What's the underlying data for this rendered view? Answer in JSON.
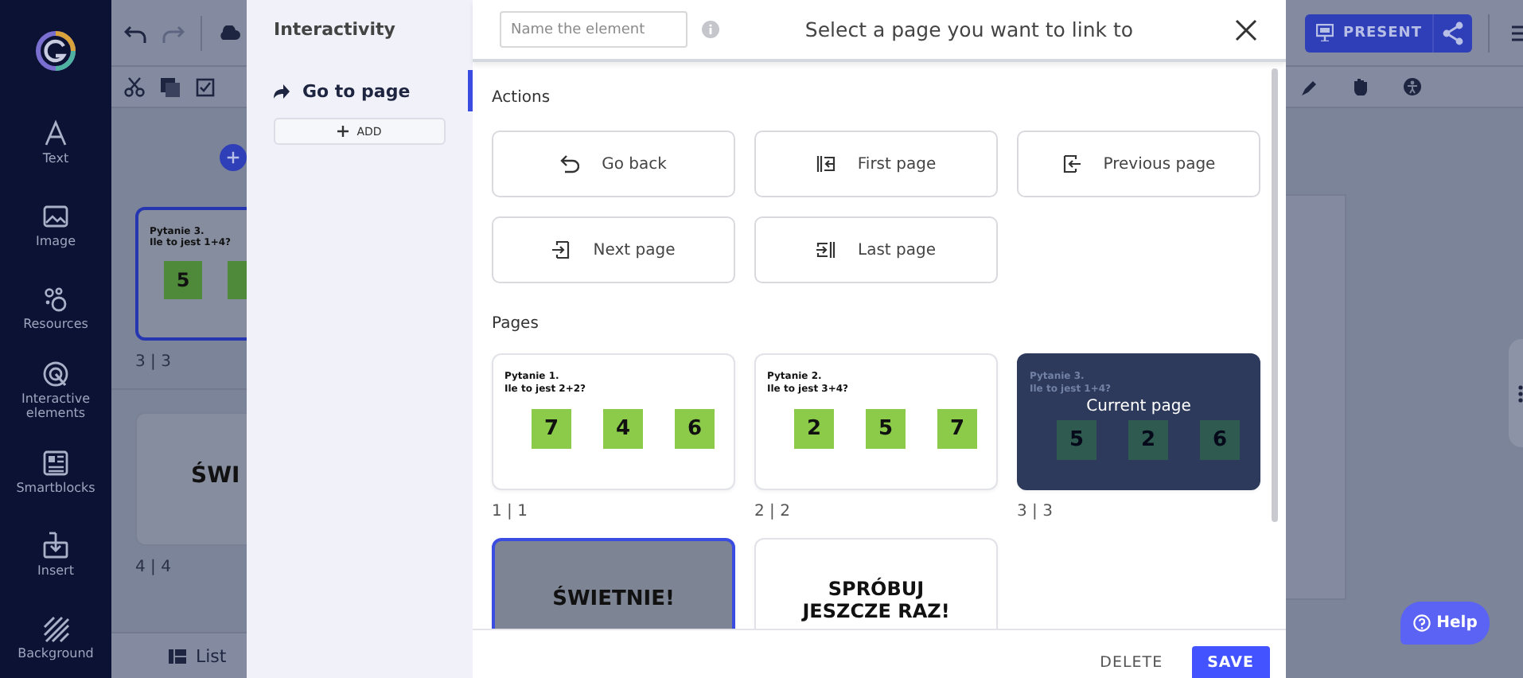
{
  "nav": {
    "items": [
      {
        "kind": "text",
        "label": "Text"
      },
      {
        "kind": "image",
        "label": "Image"
      },
      {
        "kind": "resources",
        "label": "Resources"
      },
      {
        "kind": "interactive",
        "label": "Interactive elements"
      },
      {
        "kind": "smartblocks",
        "label": "Smartblocks"
      },
      {
        "kind": "insert",
        "label": "Insert"
      },
      {
        "kind": "background",
        "label": "Background"
      }
    ]
  },
  "page_list": {
    "pages": [
      {
        "kind": "question",
        "lines": [
          "Pytanie 3.",
          "Ile to jest 1+4?"
        ],
        "answers": [
          "5"
        ],
        "number": "3 | 3",
        "selected": true
      },
      {
        "kind": "text",
        "text": "ŚWI",
        "number": "4 | 4",
        "selected": false
      }
    ],
    "list_button": "List"
  },
  "interactivity": {
    "title": "Interactivity",
    "items": [
      {
        "label": "Go to page",
        "selected": true
      }
    ],
    "add_button": "ADD"
  },
  "modal": {
    "name_field": {
      "placeholder": "Name the element"
    },
    "title": "Select a page you want to link to",
    "actions_heading": "Actions",
    "actions": [
      {
        "kind": "back",
        "label": "Go back"
      },
      {
        "kind": "first",
        "label": "First page"
      },
      {
        "kind": "previous",
        "label": "Previous page"
      },
      {
        "kind": "next",
        "label": "Next page"
      },
      {
        "kind": "last",
        "label": "Last page"
      }
    ],
    "pages_heading": "Pages",
    "pages": [
      {
        "kind": "question",
        "lines": [
          "Pytanie 1.",
          "Ile to jest 2+2?"
        ],
        "answers": [
          "7",
          "4",
          "6"
        ],
        "number": "1 | 1",
        "current": false,
        "selected": false
      },
      {
        "kind": "question",
        "lines": [
          "Pytanie 2.",
          "Ile to jest 3+4?"
        ],
        "answers": [
          "2",
          "5",
          "7"
        ],
        "number": "2 | 2",
        "current": false,
        "selected": false
      },
      {
        "kind": "question",
        "lines": [
          "Pytanie 3.",
          "Ile to jest 1+4?"
        ],
        "answers": [
          "5",
          "2",
          "6"
        ],
        "number": "3 | 3",
        "current": true,
        "overlay_label": "Current page",
        "selected": false
      },
      {
        "kind": "text",
        "text": "ŚWIETNIE!",
        "current": false,
        "selected": true
      },
      {
        "kind": "text",
        "text": "SPRÓBUJ JESZCZE RAZ!",
        "current": false,
        "selected": false
      }
    ],
    "buttons": [
      {
        "kind": "secondary",
        "label": "DELETE"
      },
      {
        "kind": "primary",
        "label": "SAVE"
      }
    ]
  },
  "top_bar": {
    "present_button": "PRESENT"
  },
  "help_button": "Help"
}
